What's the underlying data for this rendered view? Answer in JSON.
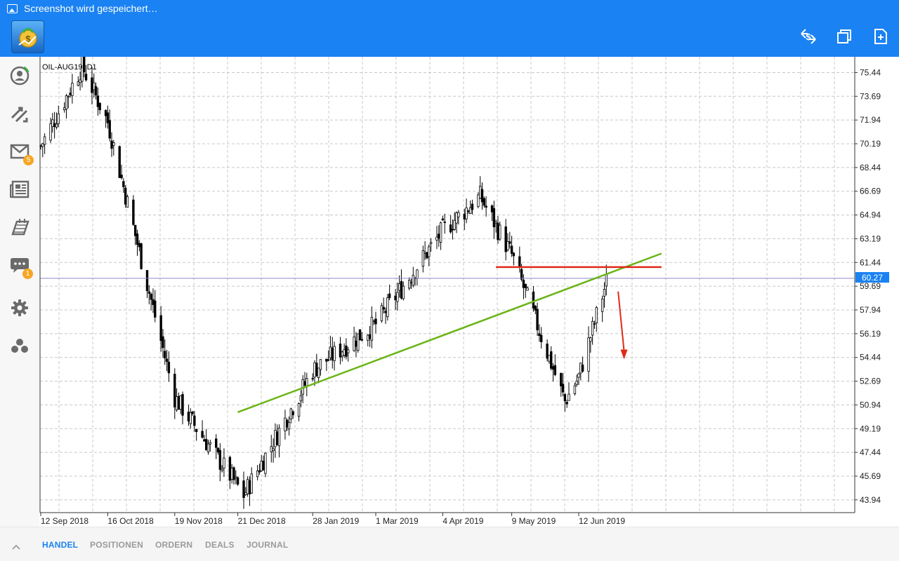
{
  "status_bar": {
    "text": "Screenshot wird gespeichert…"
  },
  "app_bar": {
    "logo_icon": "metatrader-logo-icon",
    "actions": [
      "currency-exchange-icon",
      "windows-icon",
      "new-document-icon"
    ]
  },
  "sidebar": {
    "items": [
      {
        "icon": "account-icon",
        "badge": ""
      },
      {
        "icon": "trade-icon",
        "badge": ""
      },
      {
        "icon": "mail-icon",
        "badge": "5"
      },
      {
        "icon": "news-icon",
        "badge": ""
      },
      {
        "icon": "economic-calendar-icon",
        "badge": ""
      },
      {
        "icon": "chat-icon",
        "badge": "1"
      },
      {
        "icon": "settings-icon",
        "badge": ""
      },
      {
        "icon": "community-icon",
        "badge": ""
      }
    ]
  },
  "chart": {
    "symbol_label": "OIL-AUG19, D1",
    "current_price_label": "60.27",
    "price_labels": [
      "75.44",
      "73.69",
      "71.94",
      "70.19",
      "68.44",
      "66.69",
      "64.94",
      "63.19",
      "61.44",
      "59.69",
      "57.94",
      "56.19",
      "54.44",
      "52.69",
      "50.94",
      "49.19",
      "47.44",
      "45.69",
      "43.94"
    ],
    "date_labels": [
      "12 Sep 2018",
      "16 Oct 2018",
      "19 Nov 2018",
      "21 Dec 2018",
      "28 Jan 2019",
      "1 Mar 2019",
      "4 Apr 2019",
      "9 May 2019",
      "12 Jun 2019"
    ],
    "colors": {
      "grid": "#c8c8c8",
      "candle": "#000000",
      "trendline": "#6ab416",
      "resistance": "#e02a17",
      "arrow": "#e02a17",
      "price_line": "#8d86c9",
      "price_badge": "#1a82f2"
    }
  },
  "chart_data": {
    "type": "candlestick",
    "symbol": "OIL-AUG19",
    "timeframe": "D1",
    "ylim": [
      43.0,
      76.6
    ],
    "price_ticks": [
      75.44,
      73.69,
      71.94,
      70.19,
      68.44,
      66.69,
      64.94,
      63.19,
      61.44,
      59.69,
      57.94,
      56.19,
      54.44,
      52.69,
      50.94,
      49.19,
      47.44,
      45.69,
      43.94
    ],
    "current_price": 60.27,
    "key_closes": [
      {
        "date": "12 Sep 2018",
        "close": 70.0
      },
      {
        "date": "3 Oct 2018",
        "close": 75.9
      },
      {
        "date": "16 Oct 2018",
        "close": 71.8
      },
      {
        "date": "19 Nov 2018",
        "close": 51.5
      },
      {
        "date": "24 Dec 2018",
        "close": 44.3
      },
      {
        "date": "28 Jan 2019",
        "close": 53.5
      },
      {
        "date": "1 Mar 2019",
        "close": 56.9
      },
      {
        "date": "4 Apr 2019",
        "close": 63.8
      },
      {
        "date": "23 Apr 2019",
        "close": 66.3
      },
      {
        "date": "9 May 2019",
        "close": 62.0
      },
      {
        "date": "5 Jun 2019",
        "close": 51.2
      },
      {
        "date": "12 Jun 2019",
        "close": 53.0
      },
      {
        "date": "26 Jun 2019",
        "close": 60.0
      }
    ],
    "annotations": [
      {
        "kind": "trendline",
        "from": {
          "date": "21 Dec 2018",
          "price": 50.4
        },
        "to": {
          "date": "24 Jul 2019",
          "price": 62.1
        }
      },
      {
        "kind": "horizontal",
        "price": 61.1,
        "from_date": "1 May 2019",
        "to_date": "24 Jul 2019"
      },
      {
        "kind": "arrow-down",
        "from": {
          "date": "2 Jul 2019",
          "price": 59.3
        },
        "to": {
          "date": "5 Jul 2019",
          "price": 54.4
        }
      }
    ]
  },
  "bottom_tabs": {
    "items": [
      "HANDEL",
      "POSITIONEN",
      "ORDERN",
      "DEALS",
      "JOURNAL"
    ],
    "active": "HANDEL"
  }
}
